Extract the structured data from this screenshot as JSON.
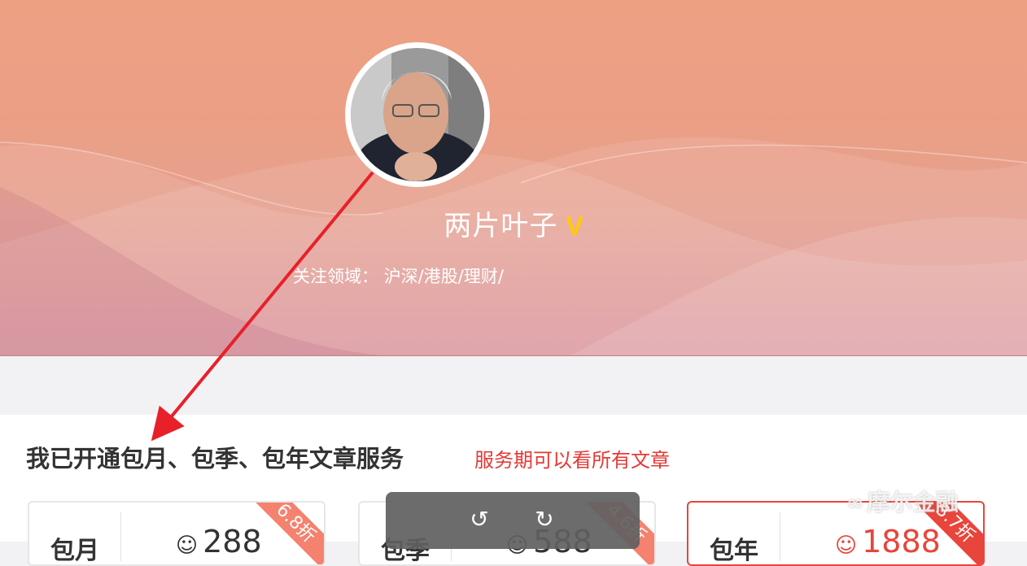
{
  "profile": {
    "name": "两片叶子",
    "vip_badge": "V",
    "focus_label": "关注领域：",
    "focus_value": "沪深/港股/理财/"
  },
  "subscription": {
    "title": "我已开通包月、包季、包年文章服务",
    "note": "服务期可以看所有文章",
    "plans": [
      {
        "type": "包月",
        "coin": "☺",
        "price": "288",
        "discount": "6.8折",
        "selected": false
      },
      {
        "type": "包季",
        "coin": "☺",
        "price": "588",
        "discount": "4.6折",
        "selected": false
      },
      {
        "type": "包年",
        "coin": "☺",
        "price": "1888",
        "discount": "3.7折",
        "selected": true
      }
    ]
  },
  "viewer_toolbar": {
    "rotate_left_icon": "↺",
    "rotate_right_icon": "↻"
  },
  "watermark": {
    "logo": "∞",
    "text": "摩尔金融"
  },
  "colors": {
    "accent_red": "#e8453c",
    "vip_gold": "#ffcc00",
    "ribbon": "#f4826e"
  }
}
